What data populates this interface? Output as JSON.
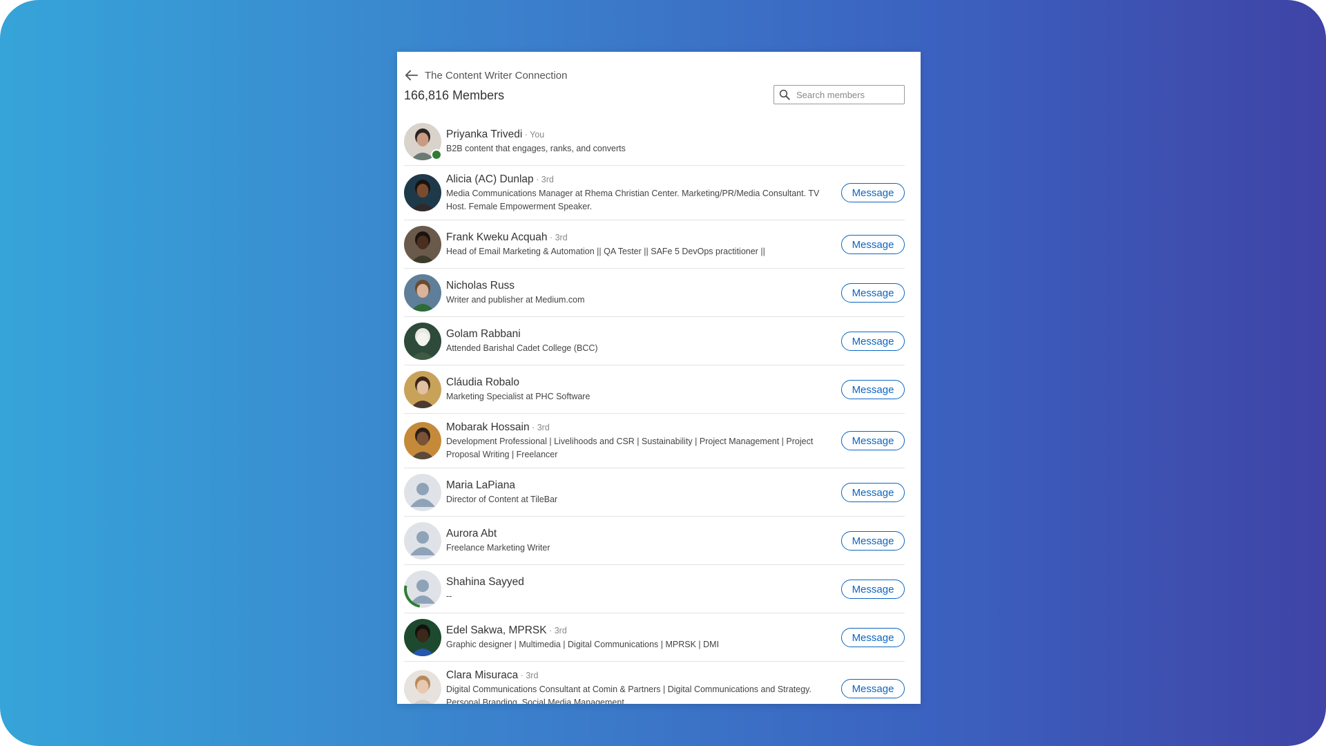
{
  "group": {
    "name": "The Content Writer Connection",
    "members_count": "166,816 Members"
  },
  "search": {
    "placeholder": "Search members"
  },
  "message_label": "Message",
  "members": [
    {
      "name": "Priyanka Trivedi",
      "degree": " · You",
      "headline": "B2B content that engages, ranks, and converts",
      "online": true,
      "has_message": false
    },
    {
      "name": "Alicia (AC) Dunlap",
      "degree": " · 3rd",
      "headline": "Media Communications Manager at Rhema Christian Center. Marketing/PR/Media Consultant. TV Host. Female Empowerment Speaker.",
      "has_message": true
    },
    {
      "name": "Frank Kweku Acquah",
      "degree": " · 3rd",
      "headline": "Head of Email Marketing & Automation || QA Tester || SAFe 5 DevOps practitioner ||",
      "has_message": true
    },
    {
      "name": "Nicholas Russ",
      "degree": "",
      "headline": "Writer and publisher at Medium.com",
      "has_message": true
    },
    {
      "name": "Golam Rabbani",
      "degree": "",
      "headline": "Attended Barishal Cadet College (BCC)",
      "has_message": true
    },
    {
      "name": "Cláudia Robalo",
      "degree": "",
      "headline": "Marketing Specialist at PHC Software",
      "has_message": true
    },
    {
      "name": "Mobarak Hossain",
      "degree": " · 3rd",
      "headline": "Development Professional | Livelihoods and CSR | Sustainability | Project Management | Project Proposal Writing | Freelancer",
      "has_message": true
    },
    {
      "name": "Maria LaPiana",
      "degree": "",
      "headline": "Director of Content at TileBar",
      "has_message": true
    },
    {
      "name": "Aurora Abt",
      "degree": "",
      "headline": "Freelance Marketing Writer",
      "has_message": true
    },
    {
      "name": "Shahina Sayyed",
      "degree": "",
      "headline": "--",
      "has_message": true
    },
    {
      "name": "Edel Sakwa, MPRSK",
      "degree": " · 3rd",
      "headline": "Graphic designer | Multimedia | Digital Communications | MPRSK | DMI",
      "has_message": true
    },
    {
      "name": "Clara Misuraca",
      "degree": " · 3rd",
      "headline": "Digital Communications Consultant at Comin & Partners | Digital Communications and Strategy. Personal Branding. Social Media Management",
      "has_message": true
    }
  ],
  "colors": {
    "accent": "#0a66c2",
    "online": "#2e7d32",
    "gradient_start": "#36a4d9",
    "gradient_end": "#3f44a6"
  },
  "icons": [
    "back-arrow-icon",
    "search-icon"
  ]
}
